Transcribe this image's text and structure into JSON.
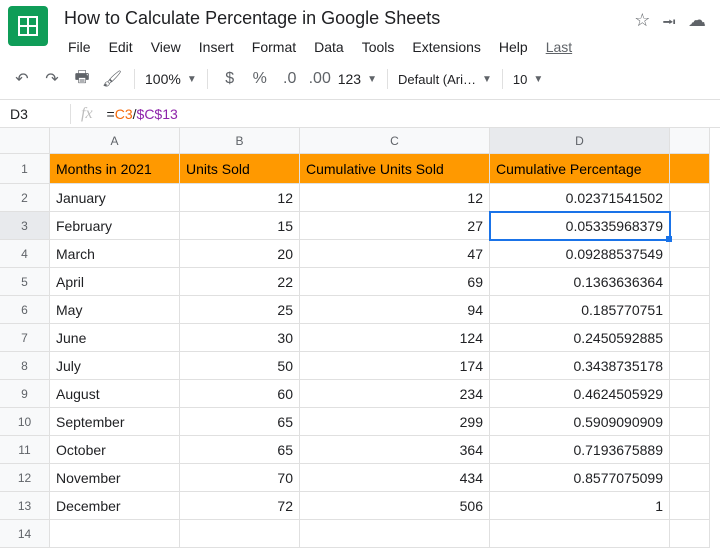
{
  "doc": {
    "title": "How to Calculate Percentage in Google Sheets"
  },
  "menu": {
    "file": "File",
    "edit": "Edit",
    "view": "View",
    "insert": "Insert",
    "format": "Format",
    "data": "Data",
    "tools": "Tools",
    "extensions": "Extensions",
    "help": "Help",
    "last": "Last"
  },
  "toolbar": {
    "zoom": "100%",
    "font": "Default (Ari…",
    "size": "10",
    "num123": "123"
  },
  "formula": {
    "cellref": "D3",
    "eq": "=",
    "ref1": "C3",
    "op": "/",
    "ref2": "$C$13"
  },
  "cols": {
    "A": "A",
    "B": "B",
    "C": "C",
    "D": "D"
  },
  "headers": {
    "A": "Months in 2021",
    "B": "Units Sold",
    "C": "Cumulative Units Sold",
    "D": "Cumulative Percentage"
  },
  "rows": [
    {
      "n": "1"
    },
    {
      "n": "2",
      "A": "January",
      "B": "12",
      "C": "12",
      "D": "0.02371541502"
    },
    {
      "n": "3",
      "A": "February",
      "B": "15",
      "C": "27",
      "D": "0.05335968379"
    },
    {
      "n": "4",
      "A": "March",
      "B": "20",
      "C": "47",
      "D": "0.09288537549"
    },
    {
      "n": "5",
      "A": "April",
      "B": "22",
      "C": "69",
      "D": "0.1363636364"
    },
    {
      "n": "6",
      "A": "May",
      "B": "25",
      "C": "94",
      "D": "0.185770751"
    },
    {
      "n": "7",
      "A": "June",
      "B": "30",
      "C": "124",
      "D": "0.2450592885"
    },
    {
      "n": "8",
      "A": "July",
      "B": "50",
      "C": "174",
      "D": "0.3438735178"
    },
    {
      "n": "9",
      "A": "August",
      "B": "60",
      "C": "234",
      "D": "0.4624505929"
    },
    {
      "n": "10",
      "A": "September",
      "B": "65",
      "C": "299",
      "D": "0.5909090909"
    },
    {
      "n": "11",
      "A": "October",
      "B": "65",
      "C": "364",
      "D": "0.7193675889"
    },
    {
      "n": "12",
      "A": "November",
      "B": "70",
      "C": "434",
      "D": "0.8577075099"
    },
    {
      "n": "13",
      "A": "December",
      "B": "72",
      "C": "506",
      "D": "1"
    },
    {
      "n": "14"
    }
  ]
}
